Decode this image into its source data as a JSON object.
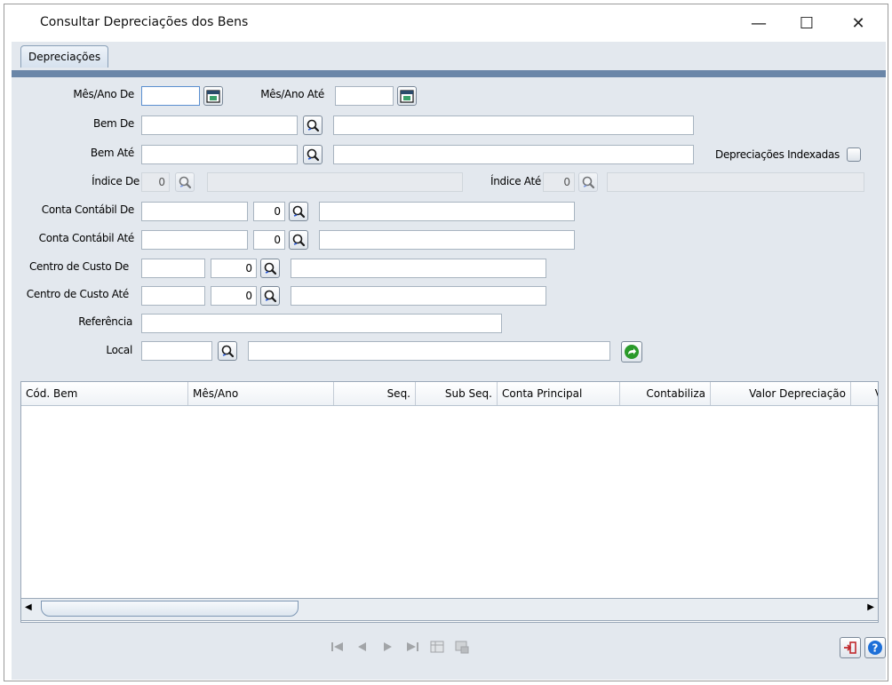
{
  "window": {
    "title": "Consultar Depreciações dos Bens",
    "minimize": "—",
    "maximize": "☐",
    "close": "✕"
  },
  "tabs": [
    {
      "label": "Depreciações"
    }
  ],
  "form": {
    "mes_ano_de": {
      "label": "Mês/Ano De",
      "value": ""
    },
    "mes_ano_ate": {
      "label": "Mês/Ano Até",
      "value": ""
    },
    "bem_de": {
      "label": "Bem De",
      "code": "",
      "description": ""
    },
    "bem_ate": {
      "label": "Bem Até",
      "code": "",
      "description": ""
    },
    "depreciacoes_indexadas": {
      "label": "Depreciações Indexadas",
      "checked": false
    },
    "indice_de": {
      "label": "Índice De",
      "value": "0",
      "description": ""
    },
    "indice_ate": {
      "label": "Índice Até",
      "value": "0",
      "description": ""
    },
    "conta_contabil_de": {
      "label": "Conta Contábil De",
      "code": "",
      "digit": "0",
      "description": ""
    },
    "conta_contabil_ate": {
      "label": "Conta Contábil Até",
      "code": "",
      "digit": "0",
      "description": ""
    },
    "centro_custo_de": {
      "label": "Centro de Custo De",
      "code": "",
      "digit": "0",
      "description": ""
    },
    "centro_custo_ate": {
      "label": "Centro de Custo Até",
      "code": "",
      "digit": "0",
      "description": ""
    },
    "referencia": {
      "label": "Referência",
      "value": ""
    },
    "local": {
      "label": "Local",
      "code": "",
      "description": ""
    }
  },
  "grid": {
    "columns": [
      "Cód. Bem",
      "Mês/Ano",
      "Seq.",
      "Sub Seq.",
      "Conta Principal",
      "Contabiliza",
      "Valor Depreciação",
      "V"
    ],
    "rows": []
  },
  "icons": {
    "calendar": "calendar-icon",
    "search": "search-icon",
    "execute": "green-arrow-icon",
    "exit": "exit-icon",
    "help": "help-icon"
  },
  "colors": {
    "panel": "#e3e8ee",
    "tab_accent": "#6a86a8",
    "help": "#1d6fd8",
    "exit": "#c0282c",
    "go": "#2a9a2a"
  }
}
